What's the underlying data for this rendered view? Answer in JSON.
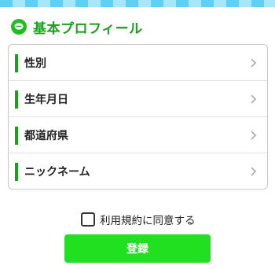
{
  "header": {
    "title": "基本プロフィール",
    "icon": "chat-bubble-icon"
  },
  "profile_fields": [
    {
      "label": "性別"
    },
    {
      "label": "生年月日"
    },
    {
      "label": "都道府県"
    },
    {
      "label": "ニックネーム"
    }
  ],
  "agreement": {
    "label": "利用規約に同意する",
    "checked": false
  },
  "submit": {
    "label": "登録"
  },
  "colors": {
    "accent": "#1aa01a",
    "button": "#20e020",
    "stripe": "#5fd0f5"
  }
}
